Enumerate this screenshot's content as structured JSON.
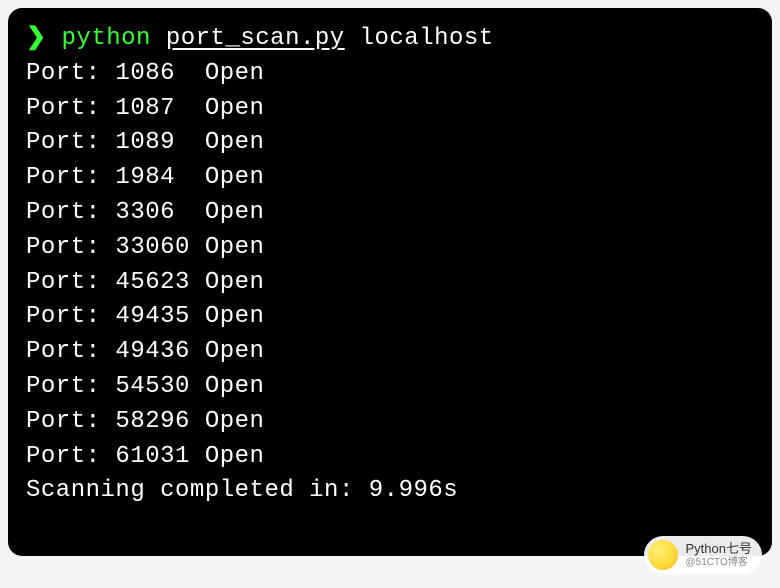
{
  "prompt": {
    "symbol": "❯",
    "command": "python",
    "script": "port_scan.py",
    "arg": "localhost"
  },
  "ports": [
    {
      "port": 1086,
      "status": "Open"
    },
    {
      "port": 1087,
      "status": "Open"
    },
    {
      "port": 1089,
      "status": "Open"
    },
    {
      "port": 1984,
      "status": "Open"
    },
    {
      "port": 3306,
      "status": "Open"
    },
    {
      "port": 33060,
      "status": "Open"
    },
    {
      "port": 45623,
      "status": "Open"
    },
    {
      "port": 49435,
      "status": "Open"
    },
    {
      "port": 49436,
      "status": "Open"
    },
    {
      "port": 54530,
      "status": "Open"
    },
    {
      "port": 58296,
      "status": "Open"
    },
    {
      "port": 61031,
      "status": "Open"
    }
  ],
  "summary": {
    "prefix": "Scanning completed in:",
    "time": "9.996s"
  },
  "watermark": {
    "title": "Python七号",
    "subtitle": "@51CTO博客"
  }
}
